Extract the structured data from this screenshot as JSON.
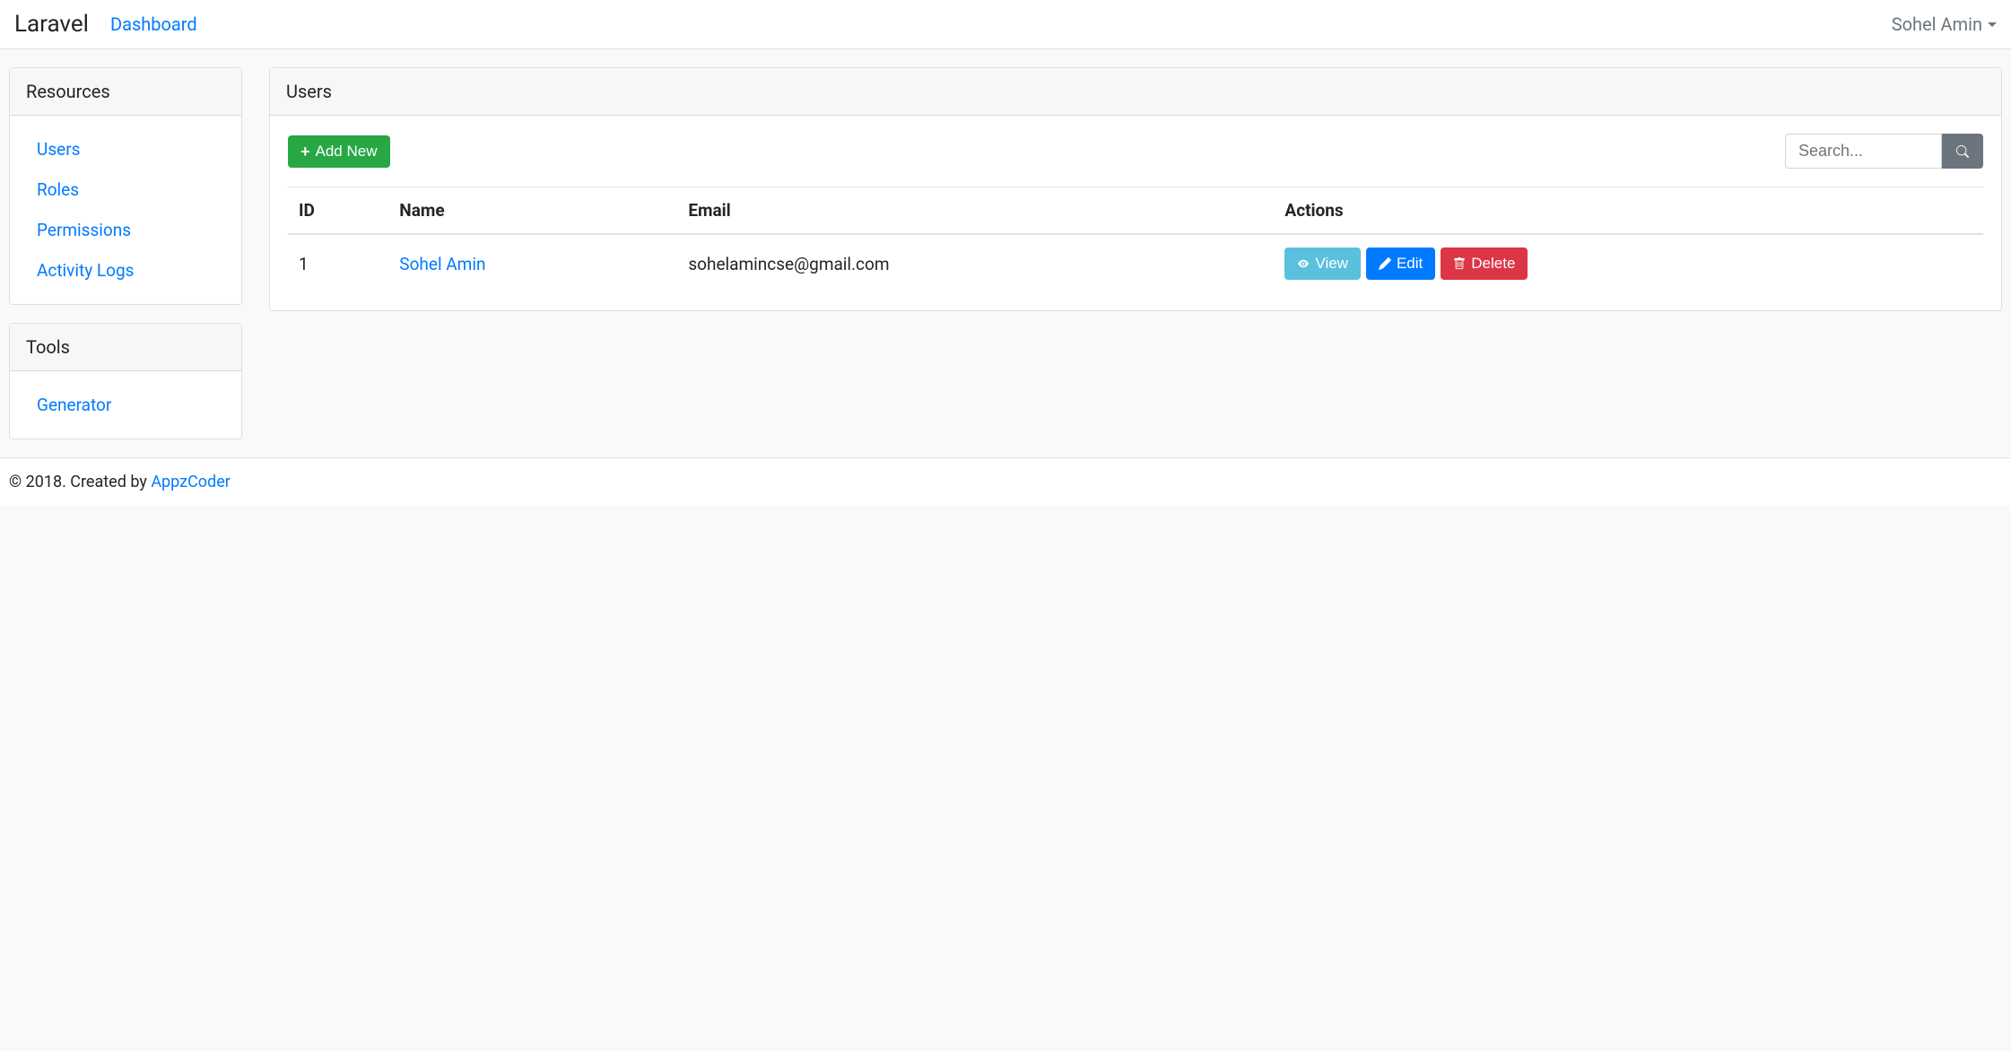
{
  "navbar": {
    "brand": "Laravel",
    "dashboard_link": "Dashboard",
    "user_name": "Sohel Amin"
  },
  "sidebar": {
    "resources": {
      "title": "Resources",
      "items": [
        "Users",
        "Roles",
        "Permissions",
        "Activity Logs"
      ]
    },
    "tools": {
      "title": "Tools",
      "items": [
        "Generator"
      ]
    }
  },
  "main": {
    "title": "Users",
    "add_button": "Add New",
    "search_placeholder": "Search...",
    "table": {
      "headers": [
        "ID",
        "Name",
        "Email",
        "Actions"
      ],
      "rows": [
        {
          "id": "1",
          "name": "Sohel Amin",
          "email": "sohelamincse@gmail.com"
        }
      ]
    },
    "actions": {
      "view": "View",
      "edit": "Edit",
      "delete": "Delete"
    }
  },
  "footer": {
    "prefix": "© 2018. Created by ",
    "link_text": "AppzCoder"
  }
}
